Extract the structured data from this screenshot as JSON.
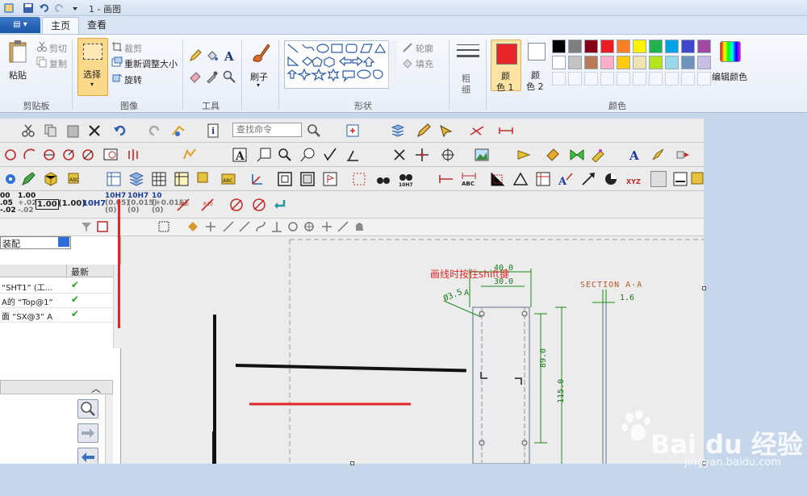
{
  "window": {
    "title": "1 - 画图"
  },
  "tabs": {
    "file": "▤ ▾",
    "home": "主页",
    "view": "查看"
  },
  "clipboard": {
    "paste": "粘贴",
    "cut": "剪切",
    "copy": "复制",
    "group": "剪贴板"
  },
  "image": {
    "select": "选择",
    "crop": "裁剪",
    "resize": "重新调整大小",
    "rotate": "旋转",
    "group": "图像"
  },
  "tools": {
    "group": "工具"
  },
  "brushes": {
    "label": "刷子"
  },
  "shapes": {
    "outline": "轮廓",
    "fill": "填充",
    "group": "形状"
  },
  "size": {
    "label1": "粗",
    "label2": "细"
  },
  "colors": {
    "color1": "颜",
    "color1b": "色 1",
    "color2": "颜",
    "color2b": "色 2",
    "edit": "编辑颜色",
    "group": "颜色",
    "row1": [
      "#000000",
      "#7f7f7f",
      "#880015",
      "#ed1c24",
      "#ff7f27",
      "#fff200",
      "#22b14c",
      "#00a2e8",
      "#3f48cc",
      "#a349a4"
    ],
    "row2": [
      "#ffffff",
      "#c3c3c3",
      "#b97a57",
      "#ffaec9",
      "#ffc90e",
      "#efe4b0",
      "#b5e61d",
      "#99d9ea",
      "#7092be",
      "#c8bfe7"
    ]
  },
  "cad": {
    "search_placeholder": "查找命令",
    "assembly": "装配",
    "column_latest": "最新",
    "rows": [
      "“SHT1” (工...",
      "A的 “Top@1”",
      "面 “SX@3” A"
    ],
    "tol_labels": [
      "1.00",
      "(1.00)",
      "10H7",
      "10H7",
      "10H7",
      "10"
    ]
  },
  "drawing": {
    "annotation": "画线时按住shift键",
    "section": "SECTION A-A",
    "dims": [
      "40.0",
      "30.0",
      "89.0",
      "115.0",
      "1.6",
      "A",
      "Ø3.5"
    ]
  },
  "watermark": {
    "brand": "Bai du 经验",
    "url": "jingyan.baidu.com"
  }
}
